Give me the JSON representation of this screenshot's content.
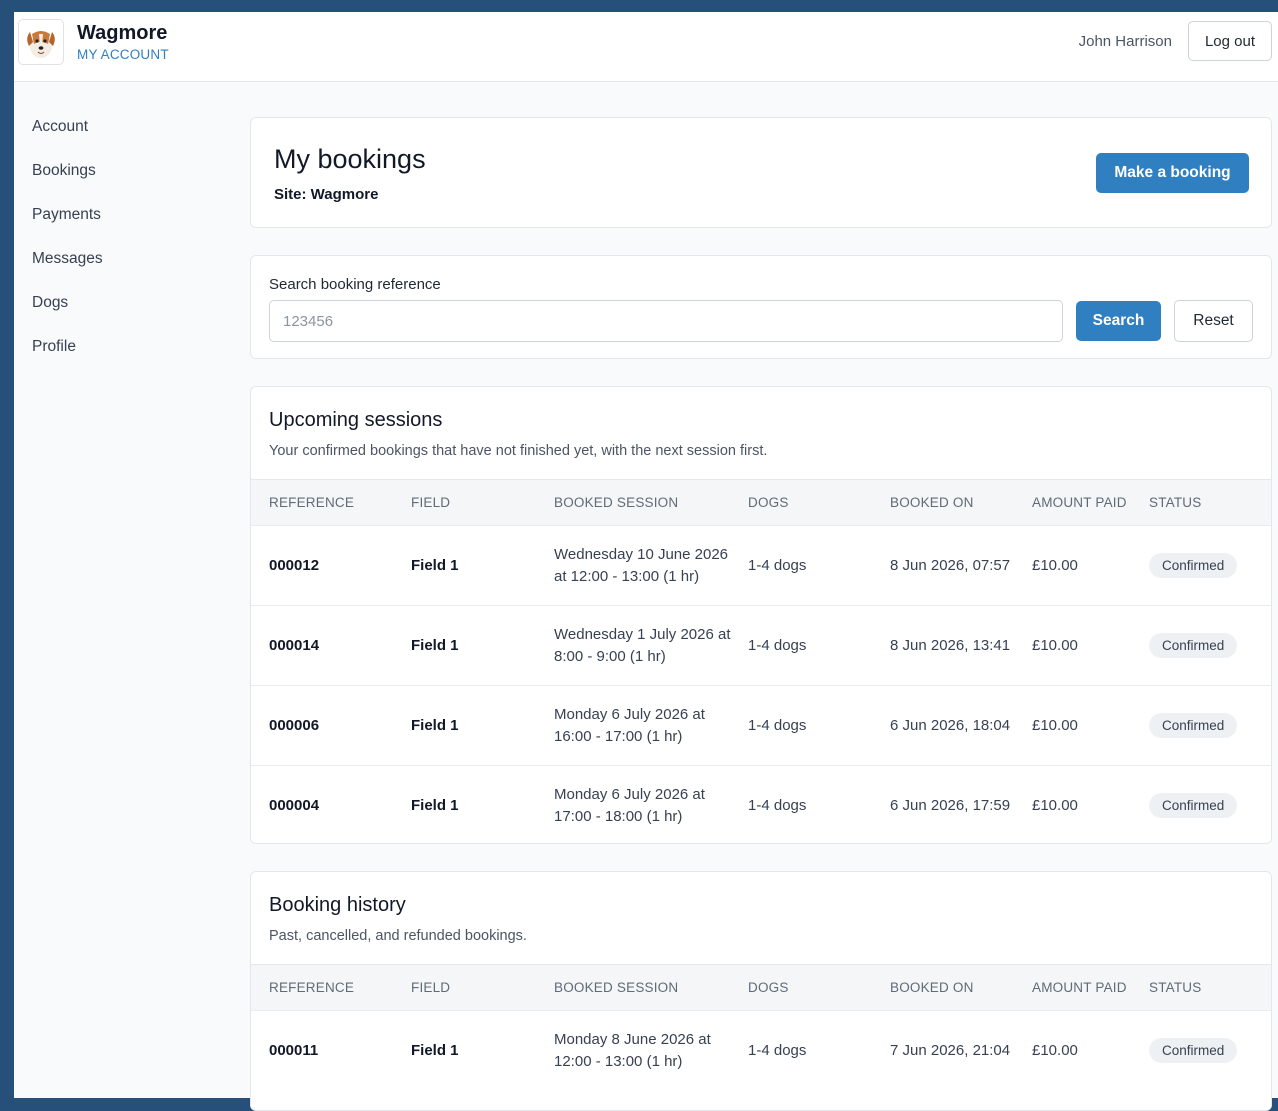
{
  "header": {
    "brand": "Wagmore",
    "subtitle": "MY ACCOUNT",
    "user_name": "John Harrison",
    "logout_label": "Log out"
  },
  "sidebar": {
    "items": [
      {
        "label": "Account"
      },
      {
        "label": "Bookings"
      },
      {
        "label": "Payments"
      },
      {
        "label": "Messages"
      },
      {
        "label": "Dogs"
      },
      {
        "label": "Profile"
      }
    ]
  },
  "page": {
    "title": "My bookings",
    "site": "Site: Wagmore",
    "make_booking_label": "Make a booking"
  },
  "search": {
    "label": "Search booking reference",
    "placeholder": "123456",
    "value": "",
    "search_label": "Search",
    "reset_label": "Reset"
  },
  "columns": [
    "REFERENCE",
    "FIELD",
    "BOOKED SESSION",
    "DOGS",
    "BOOKED ON",
    "AMOUNT PAID",
    "STATUS"
  ],
  "upcoming": {
    "title": "Upcoming sessions",
    "description": "Your confirmed bookings that have not finished yet, with the next session first.",
    "rows": [
      {
        "ref": "000012",
        "field": "Field 1",
        "session": "Wednesday 10 June 2026 at 12:00 - 13:00 (1 hr)",
        "dogs": "1-4 dogs",
        "booked_on": "8 Jun 2026, 07:57",
        "amount": "£10.00",
        "status": "Confirmed"
      },
      {
        "ref": "000014",
        "field": "Field 1",
        "session": "Wednesday 1 July 2026 at 8:00 - 9:00 (1 hr)",
        "dogs": "1-4 dogs",
        "booked_on": "8 Jun 2026, 13:41",
        "amount": "£10.00",
        "status": "Confirmed"
      },
      {
        "ref": "000006",
        "field": "Field 1",
        "session": "Monday 6 July 2026 at 16:00 - 17:00 (1 hr)",
        "dogs": "1-4 dogs",
        "booked_on": "6 Jun 2026, 18:04",
        "amount": "£10.00",
        "status": "Confirmed"
      },
      {
        "ref": "000004",
        "field": "Field 1",
        "session": "Monday 6 July 2026 at 17:00 - 18:00 (1 hr)",
        "dogs": "1-4 dogs",
        "booked_on": "6 Jun 2026, 17:59",
        "amount": "£10.00",
        "status": "Confirmed"
      }
    ]
  },
  "history": {
    "title": "Booking history",
    "description": "Past, cancelled, and refunded bookings.",
    "rows": [
      {
        "ref": "000011",
        "field": "Field 1",
        "session": "Monday 8 June 2026 at 12:00 - 13:00 (1 hr)",
        "dogs": "1-4 dogs",
        "booked_on": "7 Jun 2026, 21:04",
        "amount": "£10.00",
        "status": "Confirmed"
      }
    ]
  },
  "icons": {
    "logo": "dog-logo-icon"
  },
  "colors": {
    "accent": "#2f7fc1",
    "frame": "#26507a"
  }
}
